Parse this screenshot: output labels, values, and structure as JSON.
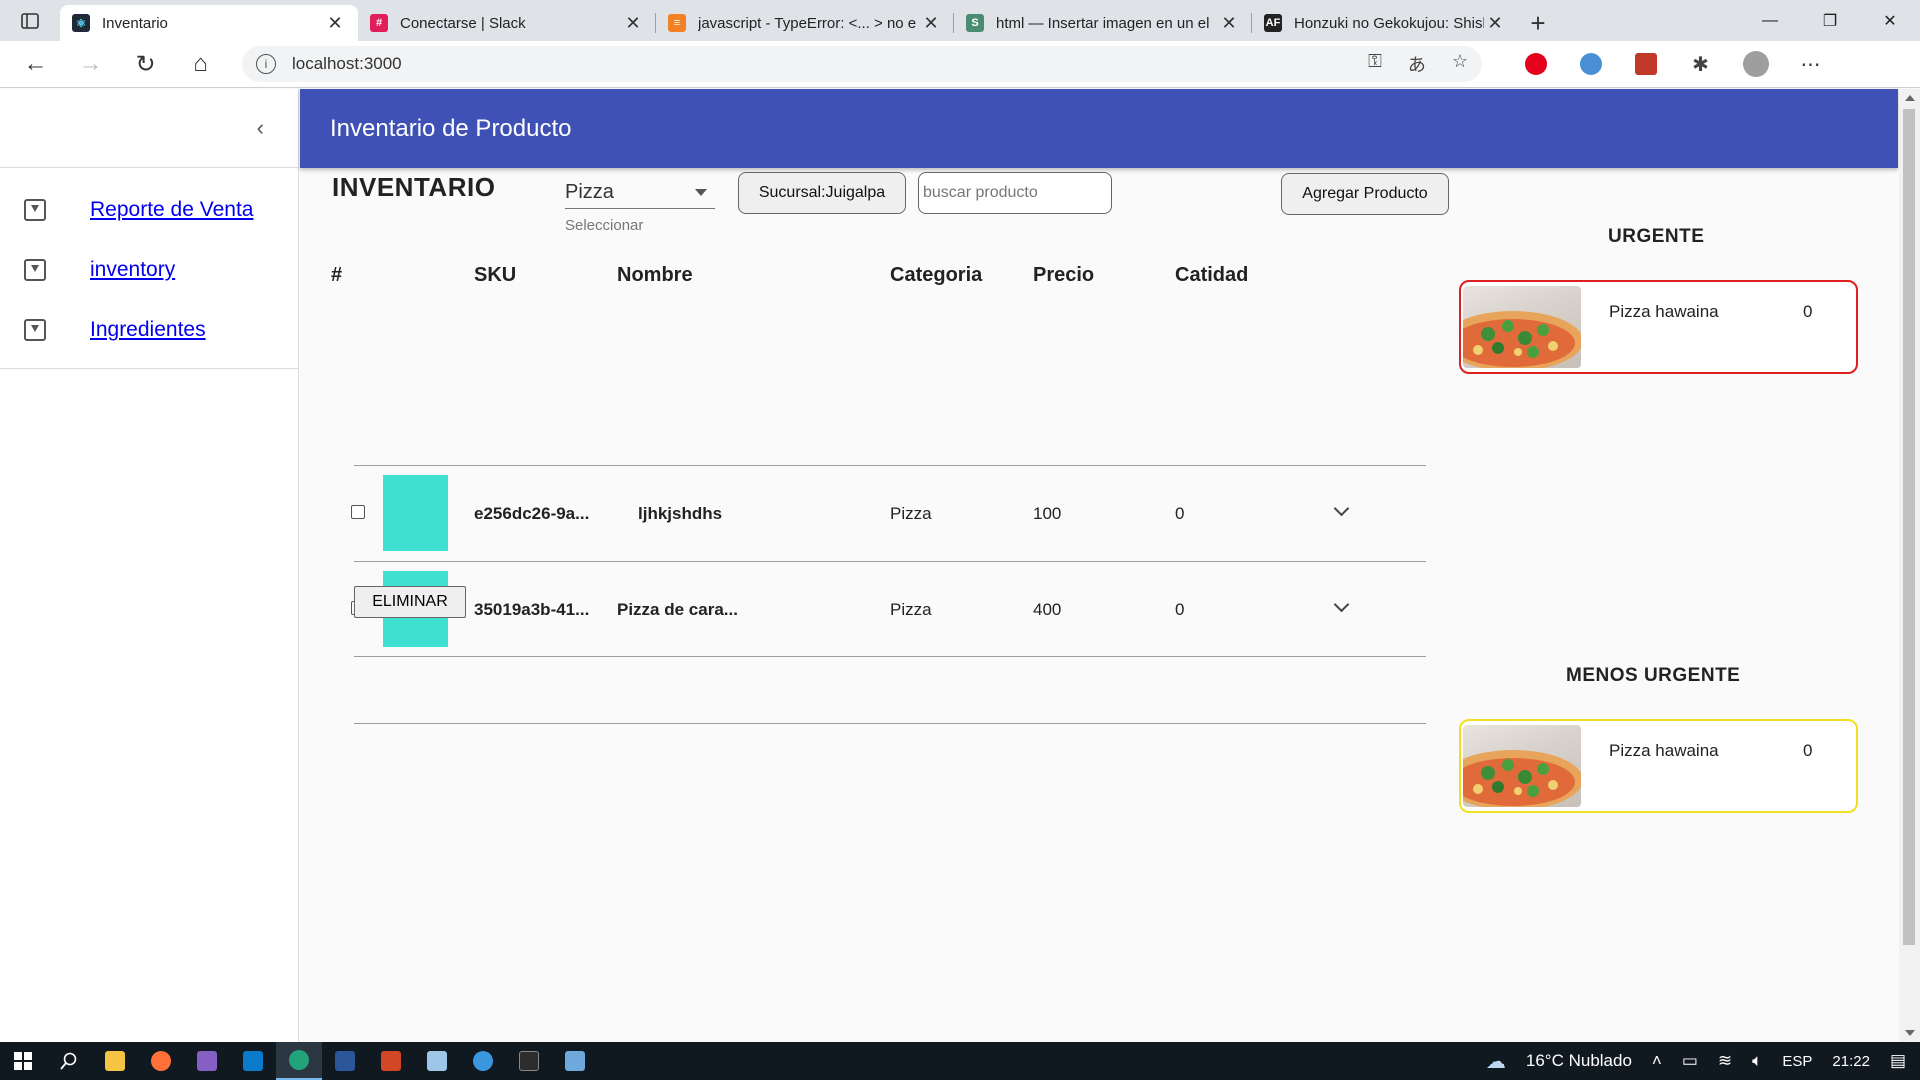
{
  "browser": {
    "tabs": [
      {
        "title": "Inventario",
        "favicon_color": "#1e2a38",
        "active": true
      },
      {
        "title": "Conectarse | Slack",
        "favicon_color": "#e01e5a",
        "active": false
      },
      {
        "title": "javascript - TypeError: <... > no e",
        "favicon_color": "#f48024",
        "active": false
      },
      {
        "title": "html — Insertar imagen en un el",
        "favicon_color": "#4a8c6f",
        "active": false
      },
      {
        "title": "Honzuki no Gekokujou: Shisho n",
        "favicon_color": "#c0392b",
        "active": false
      }
    ],
    "url": "localhost:3000"
  },
  "sidebar": {
    "items": [
      {
        "label": "Reporte de Venta"
      },
      {
        "label": "inventory"
      },
      {
        "label": "Ingredientes"
      }
    ]
  },
  "header": {
    "title": "Inventario de Producto"
  },
  "toolbar": {
    "section_title": "INVENTARIO",
    "category_value": "Pizza",
    "category_helper": "Seleccionar",
    "branch_button": "Sucursal:Juigalpa",
    "search_placeholder": "buscar producto",
    "add_button": "Agregar Producto"
  },
  "table": {
    "headers": [
      "#",
      "SKU",
      "Nombre",
      "Categoria",
      "Precio",
      "Catidad"
    ],
    "rows": [
      {
        "sku": "e256dc26-9a...",
        "name": "ljhkjshdhs",
        "category": "Pizza",
        "price": "100",
        "qty": "0"
      },
      {
        "sku": "35019a3b-41...",
        "name": "Pizza de cara...",
        "category": "Pizza",
        "price": "400",
        "qty": "0"
      }
    ],
    "delete_button": "ELIMINAR"
  },
  "urgent": {
    "title": "URGENTE",
    "border_color": "#e02020",
    "items": [
      {
        "name": "Pizza hawaina",
        "qty": "0"
      }
    ]
  },
  "less_urgent": {
    "title": "MENOS URGENTE",
    "border_color": "#f0e020",
    "items": [
      {
        "name": "Pizza hawaina",
        "qty": "0"
      }
    ]
  },
  "taskbar": {
    "weather": "16°C Nublado",
    "language": "ESP",
    "time": "21:22"
  },
  "colors": {
    "app_bar": "#3f51b5",
    "thumbnail": "#40e0d0"
  }
}
